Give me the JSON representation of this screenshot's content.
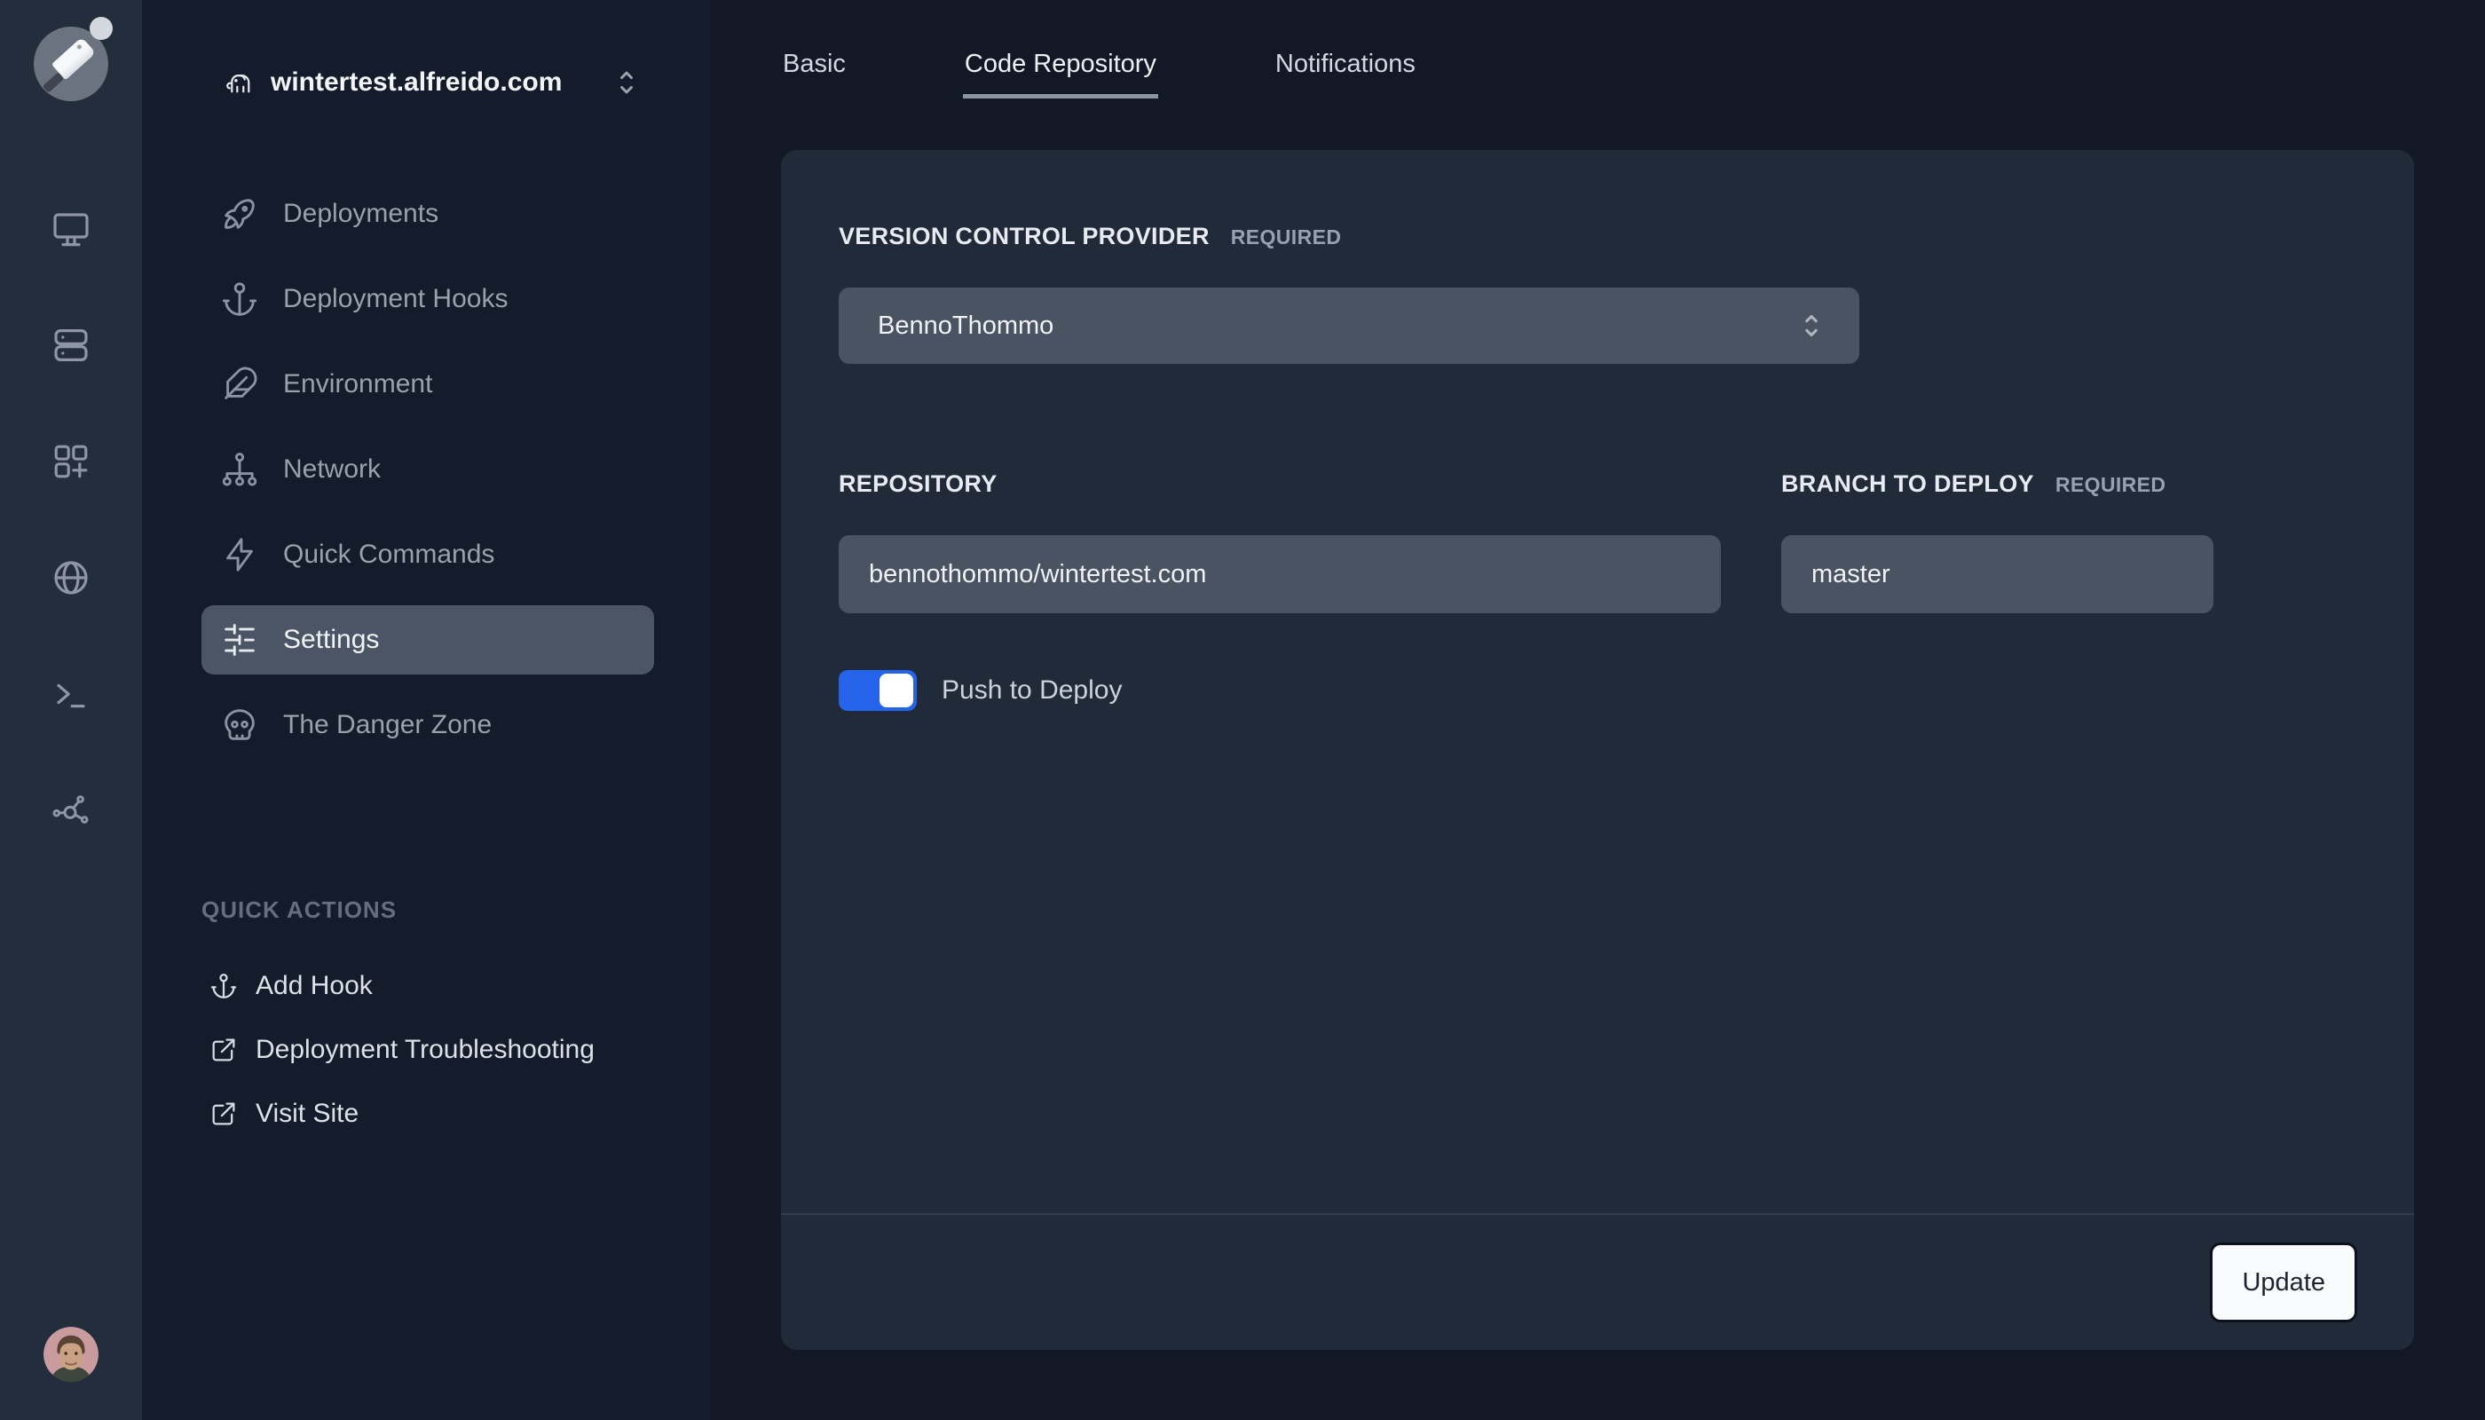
{
  "rail": {
    "logo": {
      "icon": "cleaver-logo-icon",
      "notification_dot": true
    },
    "items": [
      {
        "icon": "monitor-icon"
      },
      {
        "icon": "servers-icon"
      },
      {
        "icon": "apps-plus-icon"
      },
      {
        "icon": "globe-icon"
      },
      {
        "icon": "terminal-icon"
      },
      {
        "icon": "network-hub-icon"
      }
    ],
    "avatar": {
      "icon": "user-photo-avatar"
    }
  },
  "sidebar": {
    "site_selector": {
      "icon": "elephant-icon",
      "value": "wintertest.alfreido.com"
    },
    "menu": [
      {
        "icon": "rocket-icon",
        "label": "Deployments",
        "active": false
      },
      {
        "icon": "anchor-icon",
        "label": "Deployment Hooks",
        "active": false
      },
      {
        "icon": "feather-icon",
        "label": "Environment",
        "active": false
      },
      {
        "icon": "hierarchy-icon",
        "label": "Network",
        "active": false
      },
      {
        "icon": "bolt-icon",
        "label": "Quick Commands",
        "active": false
      },
      {
        "icon": "sliders-icon",
        "label": "Settings",
        "active": true
      },
      {
        "icon": "skull-icon",
        "label": "The Danger Zone",
        "active": false
      }
    ],
    "quick_actions_title": "QUICK ACTIONS",
    "quick_actions": [
      {
        "icon": "anchor-icon",
        "label": "Add Hook"
      },
      {
        "icon": "external-link-icon",
        "label": "Deployment Troubleshooting"
      },
      {
        "icon": "external-link-icon",
        "label": "Visit Site"
      }
    ]
  },
  "main": {
    "tabs": [
      {
        "label": "Basic",
        "active": false
      },
      {
        "label": "Code Repository",
        "active": true
      },
      {
        "label": "Notifications",
        "active": false
      }
    ],
    "form": {
      "vcs": {
        "label": "VERSION CONTROL PROVIDER",
        "required_label": "REQUIRED",
        "value": "BennoThommo"
      },
      "repository": {
        "label": "REPOSITORY",
        "value": "bennothommo/wintertest.com"
      },
      "branch": {
        "label": "BRANCH TO DEPLOY",
        "required_label": "REQUIRED",
        "value": "master"
      },
      "push_to_deploy": {
        "label": "Push to Deploy",
        "enabled": true
      }
    },
    "footer": {
      "update_label": "Update"
    }
  },
  "colors": {
    "accent_blue": "#2563eb",
    "page_bg": "#121826",
    "rail_bg": "#232d3c",
    "sidebar_bg": "#141b2a",
    "card_bg": "#212a39",
    "input_bg": "#4a5362",
    "selected_item_bg": "#4c5565",
    "update_button_bg": "#fafbfd"
  }
}
